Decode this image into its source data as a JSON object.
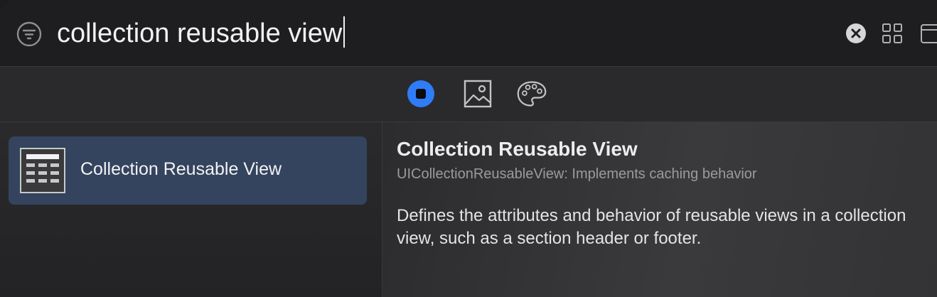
{
  "search": {
    "query": "collection reusable view"
  },
  "tabs": {
    "objects_icon": "objects-icon",
    "media_icon": "image-icon",
    "colors_icon": "palette-icon",
    "active_color": "#2f7cf6"
  },
  "results": [
    {
      "label": "Collection Reusable View",
      "icon": "collection-view-icon"
    }
  ],
  "detail": {
    "title": "Collection Reusable View",
    "subtitle": "UICollectionReusableView: Implements caching behavior",
    "description": "Defines the attributes and behavior of reusable views in a collection view, such as a section header or footer."
  }
}
